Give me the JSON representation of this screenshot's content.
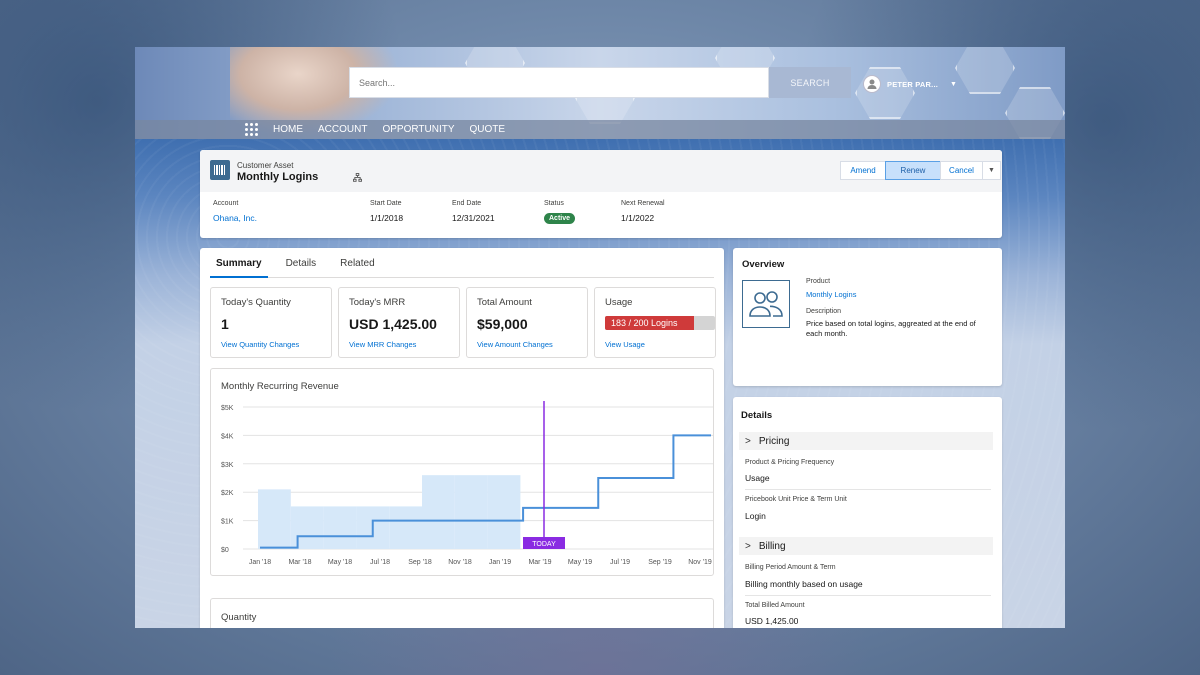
{
  "search": {
    "placeholder": "Search...",
    "button_label": "SEARCH"
  },
  "user": {
    "name": "PETER PAR..."
  },
  "nav": {
    "items": [
      "HOME",
      "ACCOUNT",
      "OPPORTUNITY",
      "QUOTE"
    ]
  },
  "record": {
    "type": "Customer Asset",
    "name": "Monthly Logins",
    "actions": {
      "amend": "Amend",
      "renew": "Renew",
      "cancel": "Cancel"
    },
    "fields": {
      "account_label": "Account",
      "account_value": "Ohana, Inc.",
      "start_label": "Start Date",
      "start_value": "1/1/2018",
      "end_label": "End Date",
      "end_value": "12/31/2021",
      "status_label": "Status",
      "status_value": "Active",
      "renewal_label": "Next Renewal",
      "renewal_value": "1/1/2022"
    }
  },
  "tabs": [
    "Summary",
    "Details",
    "Related"
  ],
  "kpis": {
    "quantity": {
      "title": "Today's Quantity",
      "value": "1",
      "link": "View Quantity Changes"
    },
    "mrr": {
      "title": "Today's MRR",
      "value": "USD 1,425.00",
      "link": "View MRR Changes"
    },
    "amount": {
      "title": "Total Amount",
      "value": "$59,000",
      "link": "View Amount Changes"
    },
    "usage": {
      "title": "Usage",
      "text": "183 / 200 Logins",
      "used": 183,
      "limit": 200,
      "link": "View Usage"
    }
  },
  "chart_data": {
    "type": "line",
    "title": "Monthly Recurring Revenue",
    "x": [
      "Jan '18",
      "Mar '18",
      "May '18",
      "Jul '18",
      "Sep '18",
      "Nov '18",
      "Jan '19",
      "Mar '19",
      "May '19",
      "Jul '19",
      "Sep '19",
      "Nov '19"
    ],
    "yticks": [
      "$0",
      "$1K",
      "$2K",
      "$3K",
      "$4K",
      "$5K"
    ],
    "ylim": [
      0,
      5000
    ],
    "series": [
      {
        "values": [
          50,
          450,
          450,
          1000,
          1000,
          1000,
          1000,
          1450,
          1450,
          2500,
          2500,
          4000,
          4000
        ]
      }
    ],
    "shaded": [
      2100,
      1500,
      1500,
      1500,
      1500,
      2600,
      2600,
      2600
    ],
    "today_marker": {
      "label": "TODAY",
      "x_index": 7.1
    },
    "grid": true
  },
  "quantity_section": {
    "title": "Quantity"
  },
  "overview": {
    "title": "Overview",
    "product_label": "Product",
    "product_value": "Monthly Logins",
    "description_label": "Description",
    "description_value": "Price based on total logins, aggreated at the end of each month."
  },
  "details": {
    "title": "Details",
    "pricing": {
      "heading": "Pricing",
      "freq_label": "Product & Pricing Frequency",
      "freq_value": "Usage",
      "unit_label": "Pricebook Unit Price & Term Unit",
      "unit_value": "Login"
    },
    "billing": {
      "heading": "Billing",
      "period_label": "Billing Period Amount & Term",
      "period_value": "Billing monthly based on usage",
      "billed_label": "Total Billed Amount",
      "billed_value": "USD 1,425.00"
    }
  },
  "colors": {
    "accent": "#0070d2",
    "line": "#4a90d9",
    "shade": "#d6e8f9",
    "today": "#8a2be2",
    "usage_fill": "#cf3a3a",
    "active": "#2e844a"
  }
}
